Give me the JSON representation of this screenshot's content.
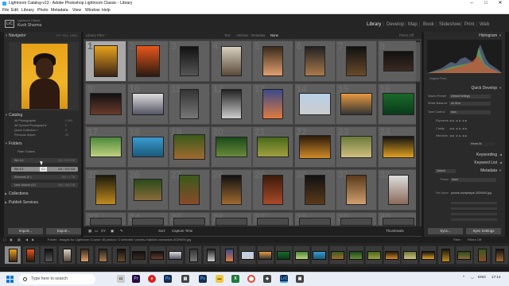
{
  "window": {
    "title": "Lightroom Catalog-v13 - Adobe Photoshop Lightroom Classic - Library",
    "controls": [
      "–",
      "□",
      "✕"
    ]
  },
  "menu": [
    "File",
    "Edit",
    "Library",
    "Photo",
    "Metadata",
    "View",
    "Window",
    "Help"
  ],
  "identity": {
    "logo": "LrC",
    "catalog_label": "Lightroom Classic",
    "user": "Kush Sharma"
  },
  "modules": [
    "Library",
    "Develop",
    "Map",
    "Book",
    "Slideshow",
    "Print",
    "Web"
  ],
  "active_module": "Library",
  "left_panel": {
    "navigator_label": "Navigator",
    "navigator_options": [
      "FIT",
      "FILL",
      "100%"
    ],
    "catalog_label": "Catalog",
    "catalog_items": [
      {
        "label": "All Photographs",
        "count": "1,904"
      },
      {
        "label": "All Synced Photographs",
        "count": "0"
      },
      {
        "label": "Quick Collection +",
        "count": "0"
      },
      {
        "label": "Previous Import",
        "count": "45"
      }
    ],
    "folders_label": "Folders",
    "filter_folders": "Filter Folders",
    "folder_items": [
      {
        "label": "Wd 4.5",
        "count": "151 / 933 GB"
      },
      {
        "label": "Wd 4.5",
        "count": "151 / 933 GB",
        "selected": true
      },
      {
        "label": "Elements (F:)",
        "count": "381 / 1 TB"
      },
      {
        "label": "New Volume (G:)",
        "count": "384 / 465 GB"
      }
    ],
    "tooltip": "C:\\",
    "collections_label": "Collections",
    "publish_label": "Publish Services",
    "import_button": "Import...",
    "export_button": "Export..."
  },
  "library_filter": {
    "label": "Library Filter :",
    "options": [
      "Text",
      "Attribute",
      "Metadata",
      "None"
    ],
    "selected": "None",
    "preset": "Filters Off"
  },
  "grid": {
    "cell_numbers": [
      "1",
      "2",
      "3",
      "4",
      "5",
      "6",
      "7",
      "8",
      "9",
      "10",
      "11",
      "12",
      "13",
      "14",
      "15",
      "16",
      "17",
      "18",
      "19",
      "20",
      "21",
      "22",
      "23",
      "24",
      "25",
      "26",
      "27",
      "28",
      "29",
      "30",
      "31",
      "32",
      "33",
      "34",
      "35",
      "36",
      "37",
      "38",
      "39",
      "40"
    ],
    "selected_index": 0
  },
  "toolbar": {
    "sort_label": "Sort:",
    "sort_value": "Capture Time",
    "thumbnails_label": "Thumbnails"
  },
  "right_panel": {
    "histogram_label": "Histogram",
    "original_photo": "Original Photo",
    "quick_develop_label": "Quick Develop",
    "saved_preset_label": "Saved Preset",
    "saved_preset_value": "Default Settings",
    "white_balance_label": "White Balance",
    "white_balance_value": "As Shot",
    "tone_control_label": "Tone Control",
    "tone_control_value": "Auto",
    "exposure_label": "Exposure",
    "clarity_label": "Clarity",
    "vibrance_label": "Vibrance",
    "reset_all": "Reset All",
    "keywording_label": "Keywording",
    "keyword_list_label": "Keyword List",
    "metadata_label": "Metadata",
    "metadata_preset": "Default",
    "preset_label": "Preset",
    "preset_value": "None",
    "file_name_label": "File Name",
    "file_name_value": "pexels-morlynstyle-2829494.jpg",
    "sync_button": "Sync...",
    "sync_settings_button": "Sync Settings"
  },
  "filmstrip_bar": {
    "source": "Folder : Images for Lightroom Course",
    "count": "45 photos / 1 selected / pexels-maksim-romashkin-3029494.jpg",
    "filter_label": "Filter :",
    "filter_value": "Filters Off"
  },
  "taskbar": {
    "search_placeholder": "Type here to search",
    "language": "ENG",
    "time": "17:14"
  },
  "colors": {
    "accent_blue": "#31a8ff",
    "panel_bg": "#2a2a2a",
    "grid_bg": "#3c3c3c",
    "selected_cell": "#a9a9a9"
  }
}
